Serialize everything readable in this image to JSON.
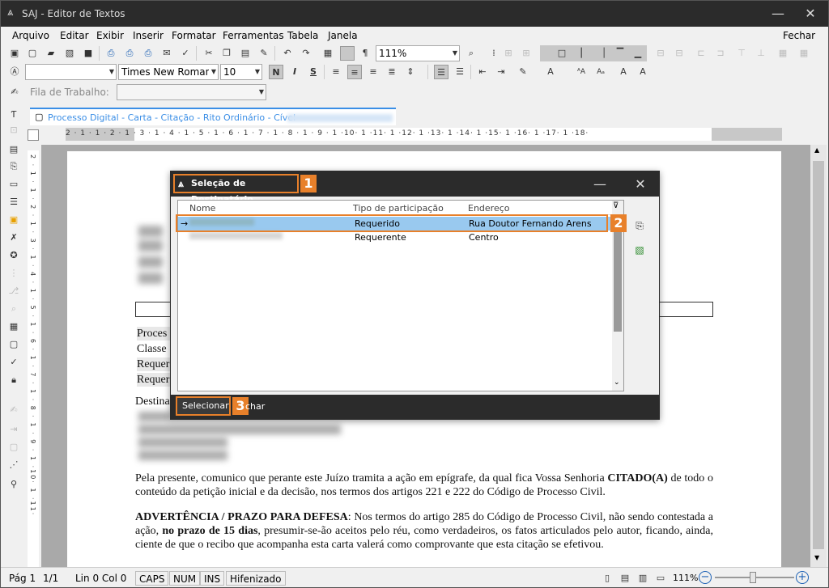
{
  "window": {
    "title": "SAJ - Editor de Textos",
    "minimize": "—",
    "close": "✕"
  },
  "menu": {
    "items": [
      "Arquivo",
      "Editar",
      "Exibir",
      "Inserir",
      "Formatar",
      "Ferramentas",
      "Tabela",
      "Janela"
    ],
    "close": "Fechar"
  },
  "toolbar": {
    "zoom": "111%",
    "font": "Times New Roman",
    "size": "10",
    "bold": "N",
    "italic": "I",
    "strike": "S",
    "pilcrow": "¶"
  },
  "worktoolbar": {
    "label": "Fila de Trabalho:"
  },
  "tab": {
    "title": "Processo Digital - Carta - Citação - Rito Ordinário - Cível"
  },
  "ruler": {
    "text": "2 · 1 · 1 · 2 · 1 · 3 · 1 · 4 · 1 · 5 · 1 · 6 · 1 · 7 · 1 · 8 · 1 · 9 · 1 ·10· 1 ·11· 1 ·12· 1 ·13· 1 ·14· 1 ·15· 1 ·16· 1 ·17· 1 ·18·"
  },
  "vruler": {
    "text": "2 · 1 · 1 · 2 · 1 · 3 · 1 · 4 · 1 · 5 · 1 · 6 · 1 · 7 · 1 · 8 · 1 · 9 · 1 ·10· 1 ·11·"
  },
  "document": {
    "labels": [
      "Proces",
      "Classe",
      "Requer",
      "Requer"
    ],
    "destina": "Destina",
    "para1_a": "Pela presente, comunico que perante este Juízo tramita a ação em epígrafe, da qual fica Vossa Senhoria ",
    "para1_b": "CITADO(A)",
    "para1_c": " de todo o conteúdo da petição inicial e da decisão, nos termos dos artigos 221 e 222 do Código de Processo Civil.",
    "para2_a": "ADVERTÊNCIA / PRAZO PARA DEFESA",
    "para2_b": ": Nos termos do artigo 285 do Código de Processo Civil, não sendo contestada a ação, ",
    "para2_c": "no prazo de 15 dias",
    "para2_d": ", presumir-se-ão aceitos pelo réu, como verdadeiros, os fatos articulados pelo autor, ficando, ainda, ciente de que o recibo que acompanha esta carta valerá como comprovante que esta citação se efetivou."
  },
  "dialog": {
    "title": "Seleção de Destinatário",
    "badges": [
      "1",
      "2",
      "3"
    ],
    "columns": [
      "Nome",
      "Tipo de participação",
      "Endereço"
    ],
    "rows": [
      {
        "marker": "→",
        "tipo": "Requerido",
        "endereco": "Rua Doutor  Fernando Arens"
      },
      {
        "marker": "",
        "tipo": "Requerente",
        "endereco": "Centro"
      }
    ],
    "select_button": "Selecionar",
    "close_button": "char"
  },
  "status": {
    "page": "Pág 1",
    "pages": "1/1",
    "linecol": "Lin 0  Col 0",
    "caps": "CAPS",
    "num": "NUM",
    "ins": "INS",
    "hyphen": "Hifenizado",
    "zoom": "111%"
  }
}
